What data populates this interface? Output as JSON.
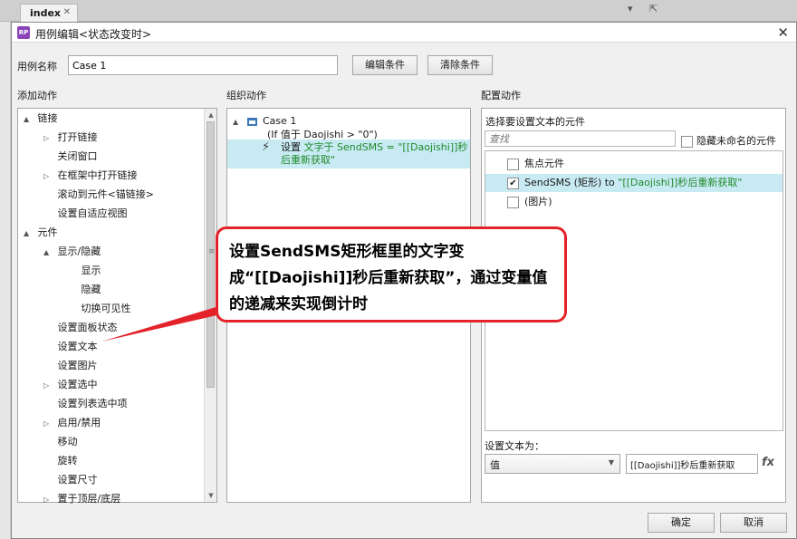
{
  "app": {
    "tab_label": "index",
    "tab_close": "✕"
  },
  "dialog": {
    "title": "用例编辑<状态改变时>",
    "close_glyph": "✕",
    "case_name_label": "用例名称",
    "case_name_value": "Case 1",
    "edit_condition_button": "编辑条件",
    "clear_condition_button": "清除条件"
  },
  "columns": {
    "add_action": "添加动作",
    "organize_action": "组织动作",
    "configure_action": "配置动作"
  },
  "action_tree": [
    {
      "label": "链接",
      "indent": 0,
      "tri": "▲"
    },
    {
      "label": "打开链接",
      "indent": 1,
      "tri": "▷"
    },
    {
      "label": "关闭窗口",
      "indent": 1,
      "tri": ""
    },
    {
      "label": "在框架中打开链接",
      "indent": 1,
      "tri": "▷"
    },
    {
      "label": "滚动到元件<锚链接>",
      "indent": 1,
      "tri": ""
    },
    {
      "label": "设置自适应视图",
      "indent": 1,
      "tri": ""
    },
    {
      "label": "元件",
      "indent": 0,
      "tri": "▲"
    },
    {
      "label": "显示/隐藏",
      "indent": 1,
      "tri": "▲"
    },
    {
      "label": "显示",
      "indent": 2,
      "tri": ""
    },
    {
      "label": "隐藏",
      "indent": 2,
      "tri": ""
    },
    {
      "label": "切换可见性",
      "indent": 2,
      "tri": ""
    },
    {
      "label": "设置面板状态",
      "indent": 1,
      "tri": ""
    },
    {
      "label": "设置文本",
      "indent": 1,
      "tri": ""
    },
    {
      "label": "设置图片",
      "indent": 1,
      "tri": ""
    },
    {
      "label": "设置选中",
      "indent": 1,
      "tri": "▷"
    },
    {
      "label": "设置列表选中项",
      "indent": 1,
      "tri": ""
    },
    {
      "label": "启用/禁用",
      "indent": 1,
      "tri": "▷"
    },
    {
      "label": "移动",
      "indent": 1,
      "tri": ""
    },
    {
      "label": "旋转",
      "indent": 1,
      "tri": ""
    },
    {
      "label": "设置尺寸",
      "indent": 1,
      "tri": ""
    },
    {
      "label": "置于顶层/底层",
      "indent": 1,
      "tri": "▷"
    }
  ],
  "organize": {
    "case_title": "Case 1",
    "condition": "(If 值于 Daojishi > \"0\")",
    "action_prefix": "设置 ",
    "action_detail": "文字于 SendSMS = \"[[Daojishi]]秒后重新获取\""
  },
  "configure": {
    "select_widgets_label": "选择要设置文本的元件",
    "search_placeholder": "查找",
    "hide_unnamed_label": "隐藏未命名的元件",
    "rows": [
      {
        "label": "焦点元件",
        "checked": false,
        "selected": false,
        "prefix": "",
        "value": ""
      },
      {
        "label": "SendSMS (矩形) to ",
        "checked": true,
        "selected": true,
        "prefix": "",
        "value": "\"[[Daojishi]]秒后重新获取\""
      },
      {
        "label": "(图片)",
        "checked": false,
        "selected": false,
        "prefix": "",
        "value": ""
      }
    ],
    "set_text_label": "设置文本为：",
    "type_select_value": "值",
    "text_value": "[[Daojishi]]秒后重新获取",
    "fx_label": "fx"
  },
  "footer": {
    "ok_button": "确定",
    "cancel_button": "取消"
  },
  "annotation": {
    "text": "设置SendSMS矩形框里的文字变成“[[Daojishi]]秒后重新获取”，通过变量值的递减来实现倒计时"
  },
  "colors": {
    "selection": "#c8eaf3",
    "callout_border": "#e3222a",
    "value_green": "#1f8a29",
    "title_icon": "#8a43b8"
  }
}
